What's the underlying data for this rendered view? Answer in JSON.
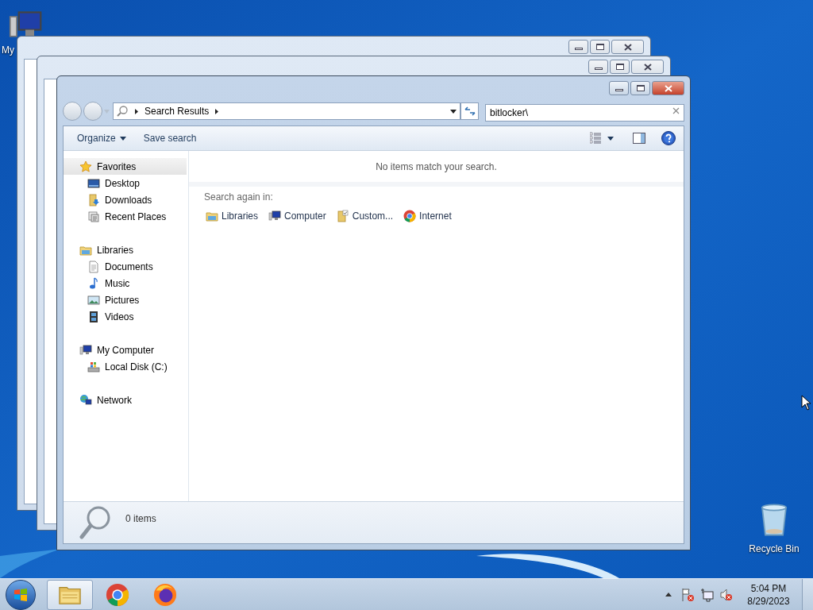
{
  "desktop_icons": [
    {
      "kind": "computer",
      "label": "My"
    },
    {
      "kind": "recycle-bin",
      "label": "Recycle Bin"
    }
  ],
  "explorer": {
    "address": {
      "crumbs": [
        "Search Results"
      ]
    },
    "search": {
      "value": "bitlocker\\"
    },
    "toolbar": [
      {
        "label": "Organize",
        "dropdown": true
      },
      {
        "label": "Save search",
        "dropdown": false
      }
    ],
    "nav": [
      {
        "label": "Favorites",
        "kind": "star",
        "selected": true,
        "children": [
          {
            "label": "Desktop",
            "kind": "desktop",
            "selected": false
          },
          {
            "label": "Downloads",
            "kind": "downloads",
            "selected": false
          },
          {
            "label": "Recent Places",
            "kind": "recent",
            "selected": false
          }
        ]
      },
      {
        "label": "Libraries",
        "kind": "libraries",
        "selected": false,
        "children": [
          {
            "label": "Documents",
            "kind": "document",
            "selected": false
          },
          {
            "label": "Music",
            "kind": "music",
            "selected": false
          },
          {
            "label": "Pictures",
            "kind": "pictures",
            "selected": false
          },
          {
            "label": "Videos",
            "kind": "videos",
            "selected": false
          }
        ]
      },
      {
        "label": "My Computer",
        "kind": "computer",
        "selected": false,
        "children": [
          {
            "label": "Local Disk (C:)",
            "kind": "disk",
            "selected": false
          }
        ]
      },
      {
        "label": "Network",
        "kind": "network",
        "selected": false
      }
    ],
    "message": "No items match your search.",
    "search_again_label": "Search again in:",
    "search_again": [
      {
        "label": "Libraries",
        "kind": "libraries"
      },
      {
        "label": "Computer",
        "kind": "computer"
      },
      {
        "label": "Custom...",
        "kind": "custom"
      },
      {
        "label": "Internet",
        "kind": "chrome"
      }
    ],
    "status": "0 items"
  },
  "taskbar": {
    "apps": [
      {
        "kind": "explorer",
        "selected": true
      },
      {
        "kind": "chrome",
        "selected": false
      },
      {
        "kind": "firefox",
        "selected": false
      }
    ],
    "time": "5:04 PM",
    "date": "8/29/2023"
  }
}
